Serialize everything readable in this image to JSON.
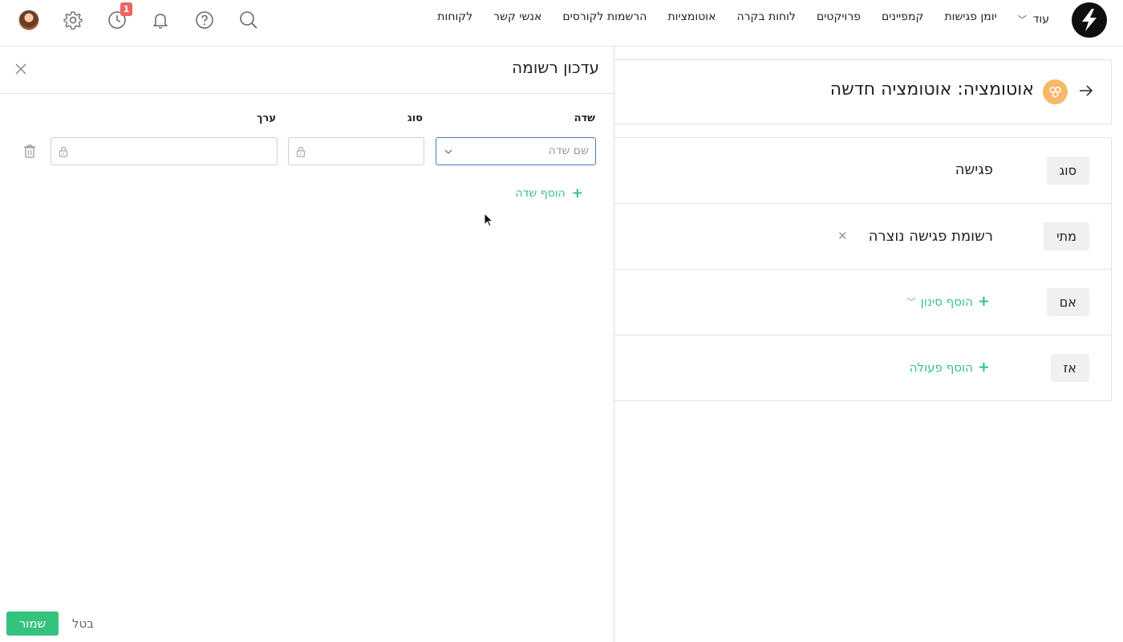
{
  "nav": {
    "items": [
      "לקוחות",
      "אנשי קשר",
      "הרשמות לקורסים",
      "אוטומציות",
      "לוחות בקרה",
      "פרויקטים",
      "קמפיינים",
      "יומן פגישות"
    ],
    "more_label": "עוד",
    "notification_count": "1"
  },
  "automation": {
    "title": "אוטומציה: אוטומציה חדשה",
    "rows": {
      "type_chip": "סוג",
      "type_value": "פגישה",
      "when_chip": "מתי",
      "when_value": "רשומת פגישה נוצרה",
      "if_chip": "אם",
      "add_filter": "הוסף סינון",
      "then_chip": "אז",
      "add_action": "הוסף פעולה"
    }
  },
  "drawer": {
    "title": "עדכון רשומה",
    "columns": {
      "field": "שדה",
      "type": "סוג",
      "value": "ערך"
    },
    "field_placeholder": "שם שדה",
    "add_field": "הוסף שדה",
    "save_label": "שמור",
    "cancel_label": "בטל"
  },
  "colors": {
    "accent_green": "#35c27d",
    "badge_red": "#f06363",
    "automation_badge": "#f7b86a",
    "focus_border": "#4d79b8"
  }
}
